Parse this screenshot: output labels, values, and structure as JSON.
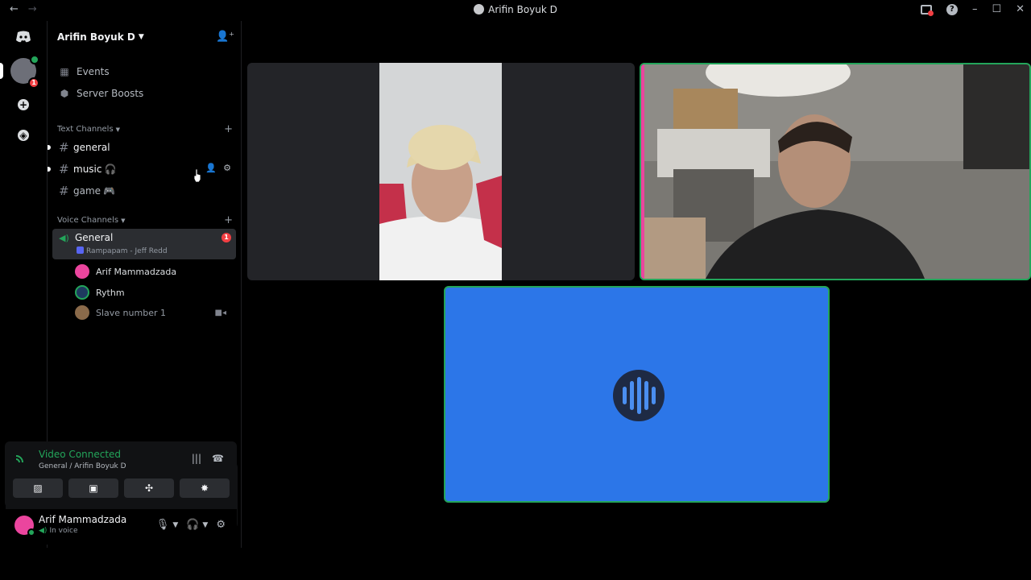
{
  "window": {
    "title": "Arifin Boyuk D"
  },
  "server": {
    "name": "Arifin Boyuk D"
  },
  "top_items": [
    {
      "label": "Events"
    },
    {
      "label": "Server Boosts"
    }
  ],
  "text_category": {
    "label": "Text Channels"
  },
  "text_channels": [
    {
      "name": "general",
      "emoji": ""
    },
    {
      "name": "music",
      "emoji": "🎧"
    },
    {
      "name": "game",
      "emoji": "🎮"
    }
  ],
  "voice_category": {
    "label": "Voice Channels"
  },
  "voice_channel": {
    "name": "General",
    "badge": "1",
    "activity": "Rampapam - Jeff Redd"
  },
  "voice_users": [
    {
      "name": "Arif Mammadzada",
      "color": "#eb459e"
    },
    {
      "name": "Rythm",
      "color": "#23a55a"
    },
    {
      "name": "Slave number 1",
      "color": "#8a6a4a"
    }
  ],
  "rail": {
    "server_badge": "1"
  },
  "voice_panel": {
    "status": "Video Connected",
    "location": "General / Arifin Boyuk D"
  },
  "user": {
    "name": "Arif Mammadzada",
    "status": "In voice"
  },
  "colors": {
    "green": "#23a55a",
    "red": "#f23f43",
    "blurple": "#5865f2",
    "tile_blue": "#2c76e8"
  }
}
